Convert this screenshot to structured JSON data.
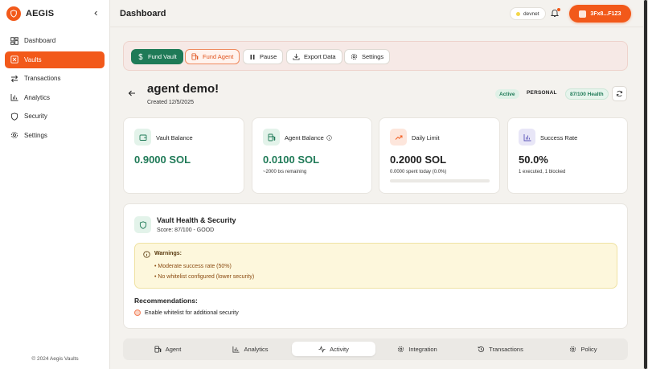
{
  "brand": {
    "name": "AEGIS",
    "footer": "© 2024 Aegis Vaults"
  },
  "sidebar": {
    "items": [
      {
        "label": "Dashboard",
        "icon": "dashboard-icon",
        "active": false
      },
      {
        "label": "Vaults",
        "icon": "vault-icon",
        "active": true
      },
      {
        "label": "Transactions",
        "icon": "transfer-icon",
        "active": false
      },
      {
        "label": "Analytics",
        "icon": "chart-icon",
        "active": false
      },
      {
        "label": "Security",
        "icon": "shield-icon",
        "active": false
      },
      {
        "label": "Settings",
        "icon": "gear-icon",
        "active": false
      }
    ]
  },
  "header": {
    "title": "Dashboard",
    "network": "devnet",
    "wallet": "3Fx8...F1Z3"
  },
  "actions": {
    "fund_vault": "Fund Vault",
    "fund_agent": "Fund Agent",
    "pause": "Pause",
    "export_data": "Export Data",
    "settings": "Settings"
  },
  "agent": {
    "name": "agent demo!",
    "created": "Created 12/5/2025",
    "status": "Active",
    "type": "PERSONAL",
    "health": "87/100 Health"
  },
  "stats": {
    "vault_balance": {
      "label": "Vault Balance",
      "value": "0.9000 SOL"
    },
    "agent_balance": {
      "label": "Agent Balance",
      "value": "0.0100 SOL",
      "sub": "~2000 txs remaining"
    },
    "daily_limit": {
      "label": "Daily Limit",
      "value": "0.2000 SOL",
      "sub": "0.0000 spent today (0.0%)",
      "progress": 0.0
    },
    "success_rate": {
      "label": "Success Rate",
      "value": "50.0%",
      "sub": "1 executed, 1 blocked"
    }
  },
  "health_panel": {
    "title": "Vault Health & Security",
    "score": "Score: 87/100 - GOOD",
    "warnings_title": "Warnings:",
    "warnings": [
      "• Moderate success rate (50%)",
      "• No whitelist configured (lower security)"
    ],
    "recommendations_title": "Recommendations:",
    "recommendations": [
      "Enable whitelist for additional security"
    ]
  },
  "tabs": [
    {
      "label": "Agent",
      "active": false
    },
    {
      "label": "Analytics",
      "active": false
    },
    {
      "label": "Activity",
      "active": true
    },
    {
      "label": "Integration",
      "active": false
    },
    {
      "label": "Transactions",
      "active": false
    },
    {
      "label": "Policy",
      "active": false
    }
  ],
  "colors": {
    "accent": "#f2591a",
    "success": "#1f7a57",
    "background": "#f4f2ee"
  }
}
